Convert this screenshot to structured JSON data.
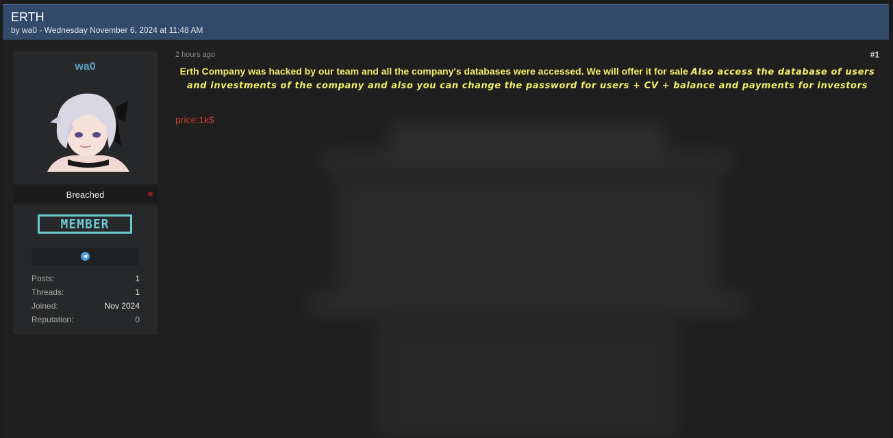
{
  "thread": {
    "title": "ERTH",
    "byline": "by wa0 - Wednesday November 6, 2024 at 11:48 AM"
  },
  "author": {
    "username": "wa0",
    "usergroup": "Breached",
    "rank_badge": "MEMBER",
    "contact_icon": "telegram-icon",
    "stats": [
      {
        "label": "Posts:",
        "value": "1"
      },
      {
        "label": "Threads:",
        "value": "1"
      },
      {
        "label": "Joined:",
        "value": "Nov 2024"
      },
      {
        "label": "Reputation:",
        "value": "0"
      }
    ]
  },
  "post": {
    "time": "2 hours ago",
    "number": "#1",
    "headline_part1": "Erth Company was hacked by our team and all the company's databases were accessed. We will offer it for sale ",
    "headline_part2": "Also access the database of users and investments of the company and also you can change the password for users + CV + balance and payments for investors",
    "price": "price:1k$"
  },
  "colors": {
    "header_bg": "#314a6a",
    "username": "#5da0c0",
    "headline": "#f3ee6a",
    "price": "#d23a2e",
    "badge": "#6ec8d0"
  }
}
